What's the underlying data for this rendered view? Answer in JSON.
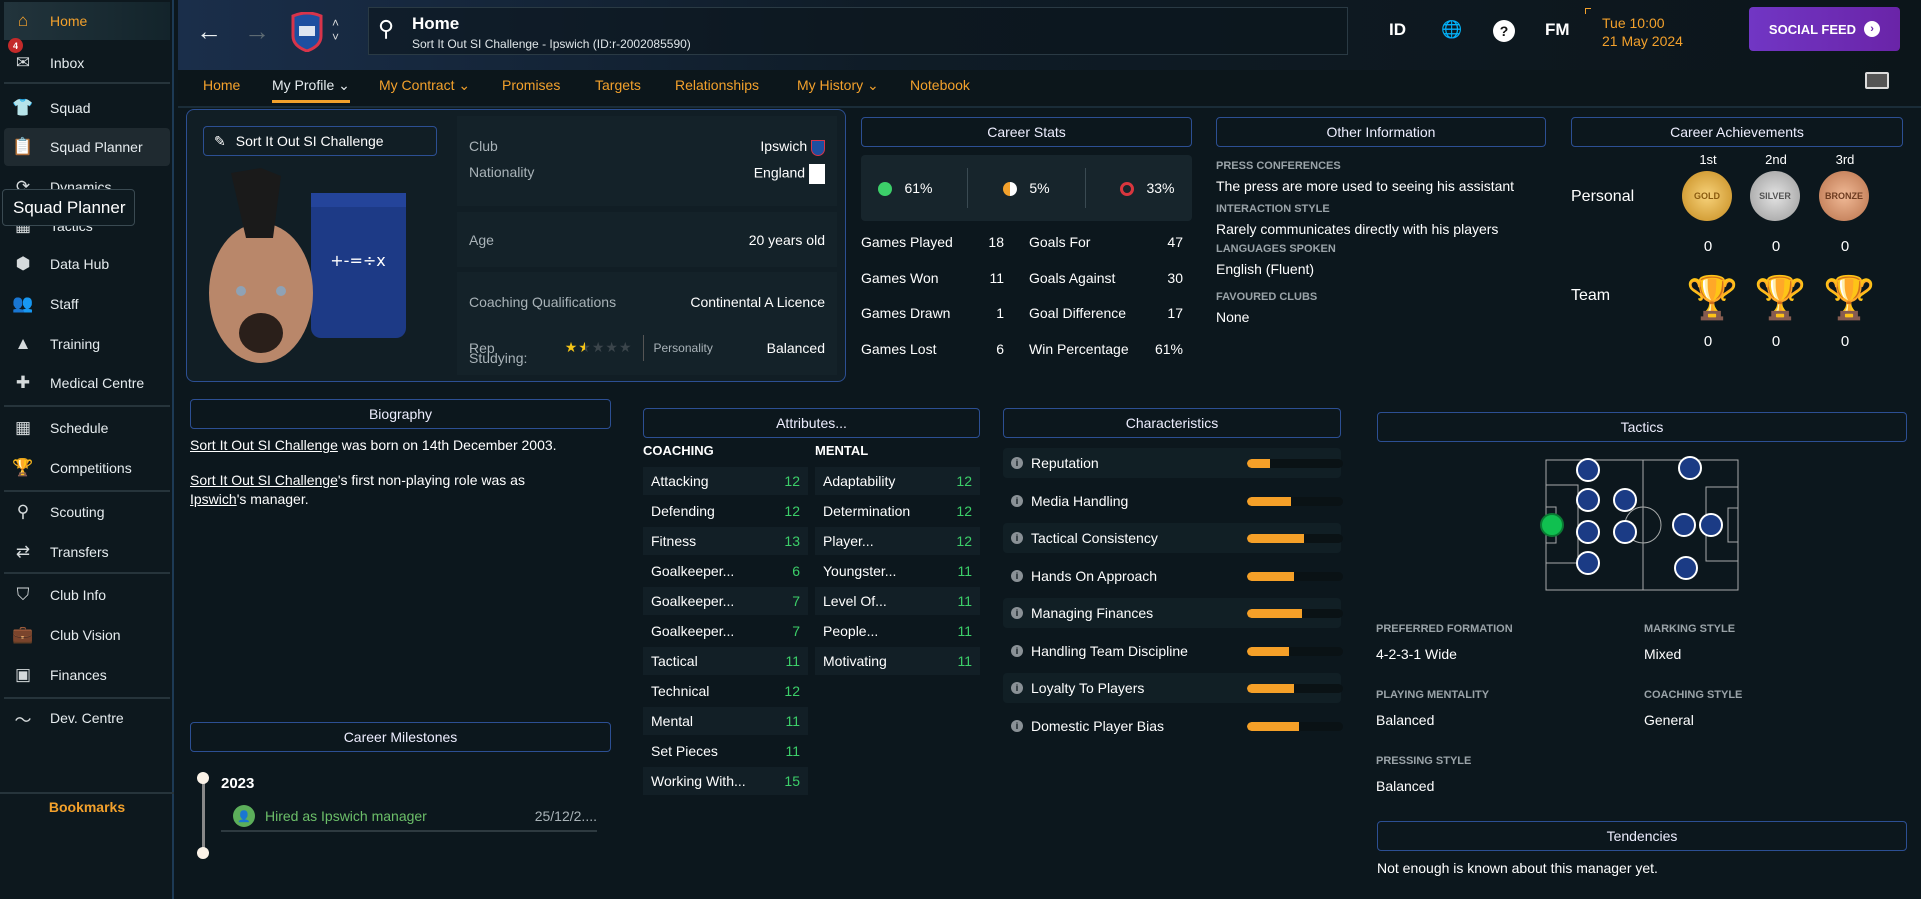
{
  "sidebar": {
    "items": [
      {
        "label": "Home",
        "icon": "home-icon"
      },
      {
        "label": "Inbox",
        "icon": "inbox-icon",
        "badge": "4"
      },
      {
        "label": "Squad",
        "icon": "shirt-icon"
      },
      {
        "label": "Squad Planner",
        "icon": "clipboard-icon"
      },
      {
        "label": "Dynamics",
        "icon": "dynamics-icon"
      },
      {
        "label": "Tactics",
        "icon": "tactics-icon"
      },
      {
        "label": "Data Hub",
        "icon": "data-hub-icon"
      },
      {
        "label": "Staff",
        "icon": "staff-icon"
      },
      {
        "label": "Training",
        "icon": "training-icon"
      },
      {
        "label": "Medical Centre",
        "icon": "medical-icon"
      },
      {
        "label": "Schedule",
        "icon": "calendar-icon"
      },
      {
        "label": "Competitions",
        "icon": "trophy-icon"
      },
      {
        "label": "Scouting",
        "icon": "search-icon"
      },
      {
        "label": "Transfers",
        "icon": "transfer-icon"
      },
      {
        "label": "Club Info",
        "icon": "shield-icon"
      },
      {
        "label": "Club Vision",
        "icon": "briefcase-icon"
      },
      {
        "label": "Finances",
        "icon": "money-icon"
      },
      {
        "label": "Dev. Centre",
        "icon": "chart-icon"
      }
    ],
    "tooltip": "Squad Planner",
    "bookmarks": "Bookmarks"
  },
  "topbar": {
    "title": "Home",
    "subtitle": "Sort It Out SI Challenge - Ipswich (ID:r-2002085590)",
    "id_label": "ID",
    "fm_label": "FM",
    "time": "Tue 10:00",
    "date": "21 May 2024",
    "social_feed": "SOCIAL FEED"
  },
  "tabs": [
    {
      "label": "Home"
    },
    {
      "label": "My Profile ⌄",
      "active": true
    },
    {
      "label": "My Contract ⌄"
    },
    {
      "label": "Promises"
    },
    {
      "label": "Targets"
    },
    {
      "label": "Relationships"
    },
    {
      "label": "My History ⌄"
    },
    {
      "label": "Notebook"
    }
  ],
  "profile": {
    "name": "Sort It Out SI Challenge",
    "club_label": "Club",
    "club": "Ipswich",
    "nationality_label": "Nationality",
    "nationality": "England",
    "age_label": "Age",
    "age": "20 years old",
    "qual_label": "Coaching Qualifications",
    "qual": "Continental A Licence",
    "rep_label": "Rep",
    "rep_stars": 1.5,
    "rep_max": 5,
    "personality_label": "Personality",
    "personality": "Balanced",
    "studying_label": "Studying:"
  },
  "career_stats": {
    "title": "Career Stats",
    "win_pct": "61%",
    "draw_pct": "5%",
    "loss_pct": "33%",
    "left": [
      [
        "Games Played",
        "18"
      ],
      [
        "Games Won",
        "11"
      ],
      [
        "Games Drawn",
        "1"
      ],
      [
        "Games Lost",
        "6"
      ]
    ],
    "right": [
      [
        "Goals For",
        "47"
      ],
      [
        "Goals Against",
        "30"
      ],
      [
        "Goal Difference",
        "17"
      ],
      [
        "Win Percentage",
        "61%"
      ]
    ]
  },
  "other_info": {
    "title": "Other Information",
    "items": [
      [
        "PRESS CONFERENCES",
        "The press are more used to seeing his assistant"
      ],
      [
        "INTERACTION STYLE",
        "Rarely communicates directly with his players"
      ],
      [
        "LANGUAGES SPOKEN",
        "English (Fluent)"
      ],
      [
        "FAVOURED CLUBS",
        "None"
      ]
    ]
  },
  "achievements": {
    "title": "Career Achievements",
    "places": [
      "1st",
      "2nd",
      "3rd"
    ],
    "medal_text": [
      "GOLD",
      "SILVER",
      "BRONZE"
    ],
    "personal_label": "Personal",
    "team_label": "Team",
    "personal": [
      "0",
      "0",
      "0"
    ],
    "team": [
      "0",
      "0",
      "0"
    ]
  },
  "biography": {
    "title": "Biography",
    "name": "Sort It Out SI Challenge",
    "line1": " was born on 14th December 2003.",
    "line2a": "'s first non-playing role was as",
    "club": "Ipswich",
    "line2b": "'s manager."
  },
  "attributes": {
    "title": "Attributes...",
    "coaching_label": "COACHING",
    "mental_label": "MENTAL",
    "coaching": [
      [
        "Attacking",
        "12"
      ],
      [
        "Defending",
        "12"
      ],
      [
        "Fitness",
        "13"
      ],
      [
        "Goalkeeper...",
        "6"
      ],
      [
        "Goalkeeper...",
        "7"
      ],
      [
        "Goalkeeper...",
        "7"
      ],
      [
        "Tactical",
        "11"
      ],
      [
        "Technical",
        "12"
      ],
      [
        "Mental",
        "11"
      ],
      [
        "Set Pieces",
        "11"
      ],
      [
        "Working With...",
        "15"
      ]
    ],
    "mental": [
      [
        "Adaptability",
        "12"
      ],
      [
        "Determination",
        "12"
      ],
      [
        "Player...",
        "12"
      ],
      [
        "Youngster...",
        "11"
      ],
      [
        "Level Of...",
        "11"
      ],
      [
        "People...",
        "11"
      ],
      [
        "Motivating",
        "11"
      ]
    ]
  },
  "characteristics": {
    "title": "Characteristics",
    "items": [
      [
        "Reputation",
        0.24
      ],
      [
        "Media Handling",
        0.46
      ],
      [
        "Tactical Consistency",
        0.59
      ],
      [
        "Hands On Approach",
        0.49
      ],
      [
        "Managing Finances",
        0.57
      ],
      [
        "Handling Team Discipline",
        0.44
      ],
      [
        "Loyalty To Players",
        0.49
      ],
      [
        "Domestic Player Bias",
        0.54
      ]
    ]
  },
  "tactics": {
    "title": "Tactics",
    "fields": [
      [
        "PREFERRED FORMATION",
        "4-2-3-1 Wide"
      ],
      [
        "MARKING STYLE",
        "Mixed"
      ],
      [
        "PLAYING MENTALITY",
        "Balanced"
      ],
      [
        "COACHING STYLE",
        "General"
      ],
      [
        "PRESSING STYLE",
        "Balanced"
      ]
    ]
  },
  "tendencies": {
    "title": "Tendencies",
    "text": "Not enough is known about this manager yet."
  },
  "milestones": {
    "title": "Career Milestones",
    "year": "2023",
    "event": "Hired as Ipswich manager",
    "date": "25/12/2...."
  },
  "colors": {
    "accent": "#f3a12c",
    "border": "#2c4f93",
    "social": "#7136c4",
    "good": "#3ccf69"
  }
}
